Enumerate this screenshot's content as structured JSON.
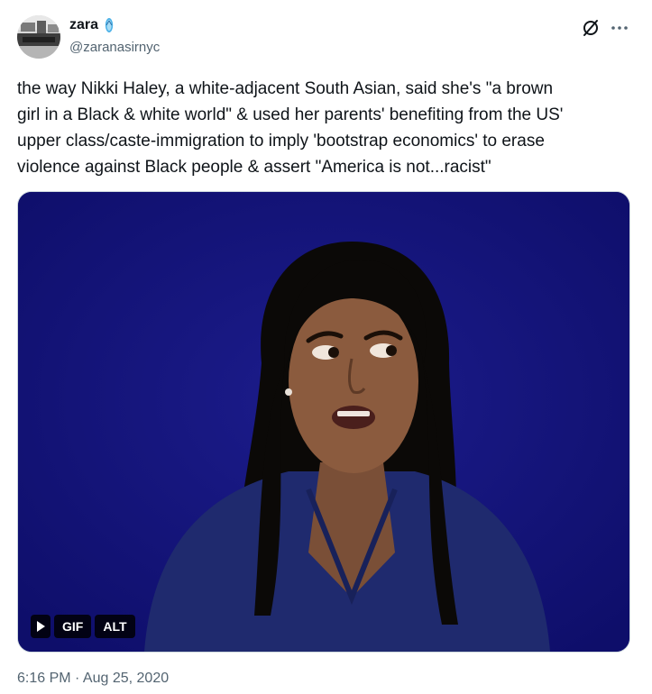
{
  "author": {
    "display_name": "zara",
    "emoji_icon": "flip-flop-icon",
    "handle": "@zaranasirnyc"
  },
  "header_icons": [
    "grok-icon",
    "more-options-icon"
  ],
  "tweet": {
    "lines": [
      "the way Nikki Haley, a white-adjacent South Asian, said she's \"a brown",
      "girl in a Black & white world\" & used her parents' benefiting from the US'",
      "upper class/caste-immigration to imply 'bootstrap economics' to erase",
      "violence against Black people & assert \"America is not...racist\""
    ]
  },
  "media": {
    "background_color": "#12127a",
    "controls": {
      "play_icon": "play-icon",
      "gif_label": "GIF",
      "alt_label": "ALT"
    }
  },
  "timestamp": "6:16 PM · Aug 25, 2020"
}
